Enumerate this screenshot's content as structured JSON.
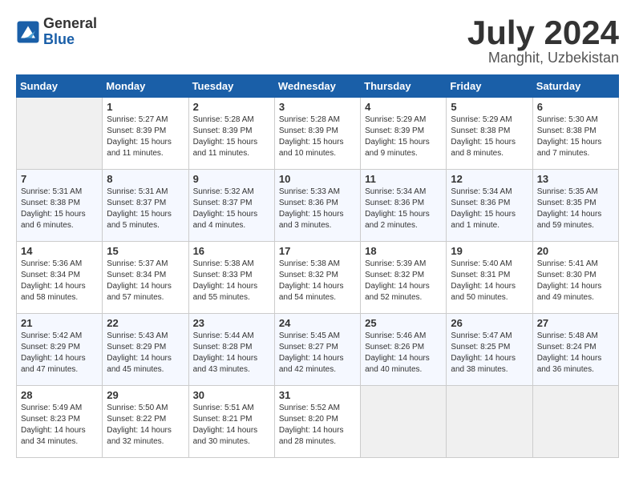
{
  "header": {
    "logo_general": "General",
    "logo_blue": "Blue",
    "month": "July 2024",
    "location": "Manghit, Uzbekistan"
  },
  "days_of_week": [
    "Sunday",
    "Monday",
    "Tuesday",
    "Wednesday",
    "Thursday",
    "Friday",
    "Saturday"
  ],
  "weeks": [
    [
      {
        "day": "",
        "info": ""
      },
      {
        "day": "1",
        "info": "Sunrise: 5:27 AM\nSunset: 8:39 PM\nDaylight: 15 hours\nand 11 minutes."
      },
      {
        "day": "2",
        "info": "Sunrise: 5:28 AM\nSunset: 8:39 PM\nDaylight: 15 hours\nand 11 minutes."
      },
      {
        "day": "3",
        "info": "Sunrise: 5:28 AM\nSunset: 8:39 PM\nDaylight: 15 hours\nand 10 minutes."
      },
      {
        "day": "4",
        "info": "Sunrise: 5:29 AM\nSunset: 8:39 PM\nDaylight: 15 hours\nand 9 minutes."
      },
      {
        "day": "5",
        "info": "Sunrise: 5:29 AM\nSunset: 8:38 PM\nDaylight: 15 hours\nand 8 minutes."
      },
      {
        "day": "6",
        "info": "Sunrise: 5:30 AM\nSunset: 8:38 PM\nDaylight: 15 hours\nand 7 minutes."
      }
    ],
    [
      {
        "day": "7",
        "info": "Sunrise: 5:31 AM\nSunset: 8:38 PM\nDaylight: 15 hours\nand 6 minutes."
      },
      {
        "day": "8",
        "info": "Sunrise: 5:31 AM\nSunset: 8:37 PM\nDaylight: 15 hours\nand 5 minutes."
      },
      {
        "day": "9",
        "info": "Sunrise: 5:32 AM\nSunset: 8:37 PM\nDaylight: 15 hours\nand 4 minutes."
      },
      {
        "day": "10",
        "info": "Sunrise: 5:33 AM\nSunset: 8:36 PM\nDaylight: 15 hours\nand 3 minutes."
      },
      {
        "day": "11",
        "info": "Sunrise: 5:34 AM\nSunset: 8:36 PM\nDaylight: 15 hours\nand 2 minutes."
      },
      {
        "day": "12",
        "info": "Sunrise: 5:34 AM\nSunset: 8:36 PM\nDaylight: 15 hours\nand 1 minute."
      },
      {
        "day": "13",
        "info": "Sunrise: 5:35 AM\nSunset: 8:35 PM\nDaylight: 14 hours\nand 59 minutes."
      }
    ],
    [
      {
        "day": "14",
        "info": "Sunrise: 5:36 AM\nSunset: 8:34 PM\nDaylight: 14 hours\nand 58 minutes."
      },
      {
        "day": "15",
        "info": "Sunrise: 5:37 AM\nSunset: 8:34 PM\nDaylight: 14 hours\nand 57 minutes."
      },
      {
        "day": "16",
        "info": "Sunrise: 5:38 AM\nSunset: 8:33 PM\nDaylight: 14 hours\nand 55 minutes."
      },
      {
        "day": "17",
        "info": "Sunrise: 5:38 AM\nSunset: 8:32 PM\nDaylight: 14 hours\nand 54 minutes."
      },
      {
        "day": "18",
        "info": "Sunrise: 5:39 AM\nSunset: 8:32 PM\nDaylight: 14 hours\nand 52 minutes."
      },
      {
        "day": "19",
        "info": "Sunrise: 5:40 AM\nSunset: 8:31 PM\nDaylight: 14 hours\nand 50 minutes."
      },
      {
        "day": "20",
        "info": "Sunrise: 5:41 AM\nSunset: 8:30 PM\nDaylight: 14 hours\nand 49 minutes."
      }
    ],
    [
      {
        "day": "21",
        "info": "Sunrise: 5:42 AM\nSunset: 8:29 PM\nDaylight: 14 hours\nand 47 minutes."
      },
      {
        "day": "22",
        "info": "Sunrise: 5:43 AM\nSunset: 8:29 PM\nDaylight: 14 hours\nand 45 minutes."
      },
      {
        "day": "23",
        "info": "Sunrise: 5:44 AM\nSunset: 8:28 PM\nDaylight: 14 hours\nand 43 minutes."
      },
      {
        "day": "24",
        "info": "Sunrise: 5:45 AM\nSunset: 8:27 PM\nDaylight: 14 hours\nand 42 minutes."
      },
      {
        "day": "25",
        "info": "Sunrise: 5:46 AM\nSunset: 8:26 PM\nDaylight: 14 hours\nand 40 minutes."
      },
      {
        "day": "26",
        "info": "Sunrise: 5:47 AM\nSunset: 8:25 PM\nDaylight: 14 hours\nand 38 minutes."
      },
      {
        "day": "27",
        "info": "Sunrise: 5:48 AM\nSunset: 8:24 PM\nDaylight: 14 hours\nand 36 minutes."
      }
    ],
    [
      {
        "day": "28",
        "info": "Sunrise: 5:49 AM\nSunset: 8:23 PM\nDaylight: 14 hours\nand 34 minutes."
      },
      {
        "day": "29",
        "info": "Sunrise: 5:50 AM\nSunset: 8:22 PM\nDaylight: 14 hours\nand 32 minutes."
      },
      {
        "day": "30",
        "info": "Sunrise: 5:51 AM\nSunset: 8:21 PM\nDaylight: 14 hours\nand 30 minutes."
      },
      {
        "day": "31",
        "info": "Sunrise: 5:52 AM\nSunset: 8:20 PM\nDaylight: 14 hours\nand 28 minutes."
      },
      {
        "day": "",
        "info": ""
      },
      {
        "day": "",
        "info": ""
      },
      {
        "day": "",
        "info": ""
      }
    ]
  ]
}
